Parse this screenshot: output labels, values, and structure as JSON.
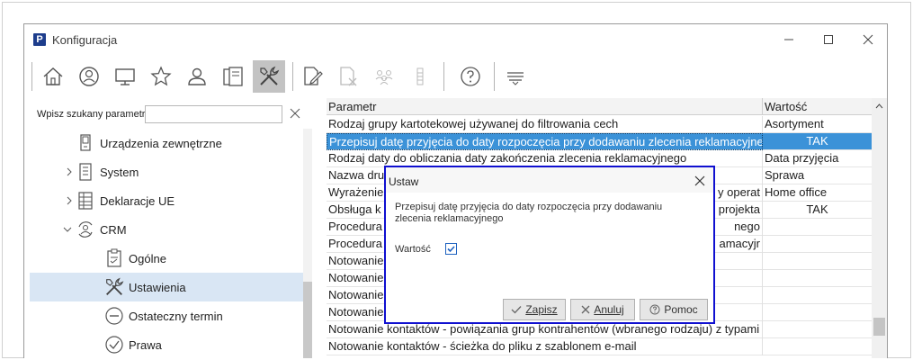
{
  "window": {
    "title": "Konfiguracja",
    "app_icon": "P"
  },
  "toolbar": {
    "icons": [
      "home-icon",
      "company-icon",
      "computer-icon",
      "star-icon",
      "user-icon",
      "devices-icon",
      "tools-icon",
      "edit-document-icon",
      "delete-document-icon",
      "users-group-icon",
      "columns-icon",
      "help-icon",
      "menu-lines-icon"
    ]
  },
  "search": {
    "label": "Wpisz szukany parametr",
    "value": ""
  },
  "tree": {
    "items": [
      {
        "label": "Urządzenia zewnętrzne",
        "icon": "device-icon"
      },
      {
        "label": "System",
        "icon": "system-icon"
      },
      {
        "label": "Deklaracje UE",
        "icon": "table-icon"
      },
      {
        "label": "CRM",
        "icon": "crm-icon"
      },
      {
        "label": "Ogólne",
        "icon": "checklist-icon"
      },
      {
        "label": "Ustawienia",
        "icon": "tools-icon"
      },
      {
        "label": "Ostateczny termin",
        "icon": "minus-circle-icon"
      },
      {
        "label": "Prawa",
        "icon": "check-circle-icon"
      }
    ]
  },
  "grid": {
    "headers": {
      "param": "Parametr",
      "value": "Wartość"
    },
    "rows": [
      {
        "param": "Rodzaj grupy kartotekowej używanej do filtrowania cech",
        "value": "Asortyment"
      },
      {
        "param": "Przepisuj datę przyjęcia do daty rozpoczęcia przy dodawaniu zlecenia reklamacyjnego",
        "value": "TAK"
      },
      {
        "param": "Rodzaj daty do obliczania daty zakończenia zlecenia reklamacyjnego",
        "value": "Data przyjęcia"
      },
      {
        "param": "Nazwa dru",
        "value": "Sprawa"
      },
      {
        "param": "Wyrażenie",
        "tail": "y operat",
        "value": "Home office"
      },
      {
        "param": "Obsługa k",
        "tail": "projekta",
        "value": "TAK"
      },
      {
        "param": "Procedura",
        "tail": "nego",
        "value": ""
      },
      {
        "param": "Procedura",
        "tail": "amacyjr",
        "value": ""
      },
      {
        "param": "Notowanie",
        "value": ""
      },
      {
        "param": "Notowanie",
        "value": ""
      },
      {
        "param": "Notowanie",
        "value": ""
      },
      {
        "param": "Notowanie",
        "value": ""
      },
      {
        "param": "Notowanie kontaktów - powiązania grup kontrahentów (wbranego rodzaju) z typami",
        "value": ""
      },
      {
        "param": "Notowanie kontaktów - ścieżka do pliku z szablonem e-mail",
        "value": ""
      }
    ]
  },
  "dialog": {
    "title": "Ustaw",
    "message": "Przepisuj datę przyjęcia do daty rozpoczęcia przy dodawaniu zlecenia reklamacyjnego",
    "value_label": "Wartość",
    "checked": true,
    "buttons": {
      "save": "Zapisz",
      "cancel": "Anuluj",
      "help": "Pomoc"
    }
  }
}
